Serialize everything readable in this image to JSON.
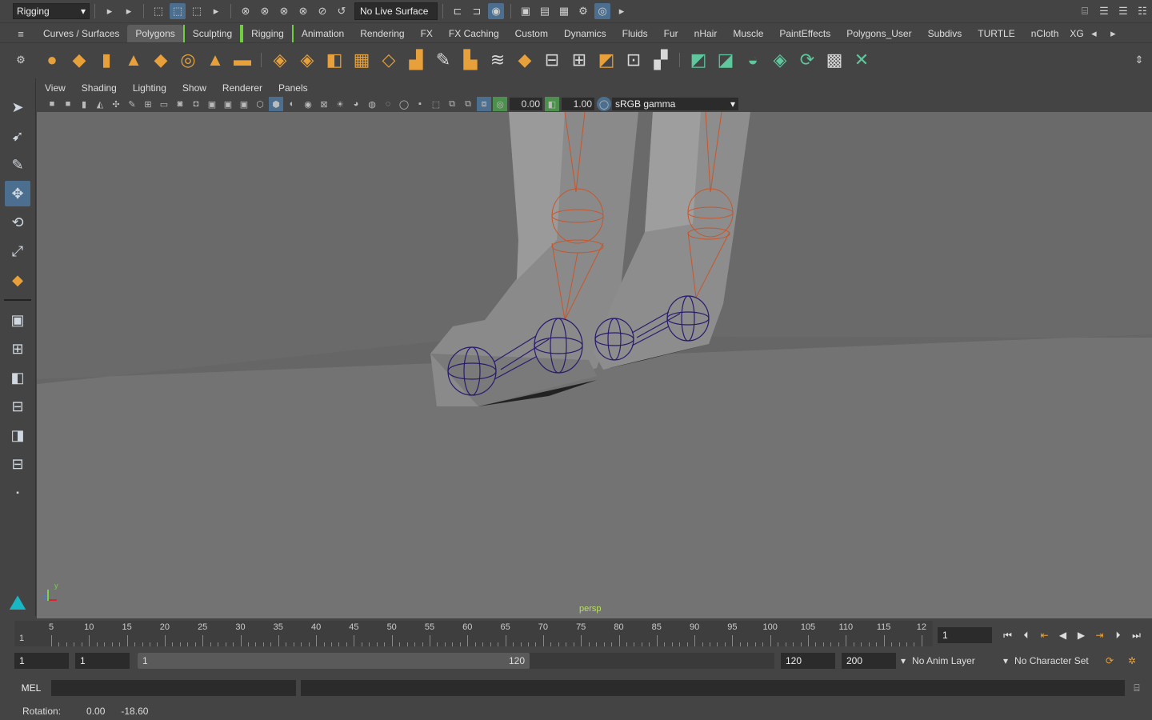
{
  "status_line": {
    "menu_set": "Rigging",
    "live_surface": "No Live Surface"
  },
  "shelf_tabs": [
    "Curves / Surfaces",
    "Polygons",
    "Sculpting",
    "Rigging",
    "Animation",
    "Rendering",
    "FX",
    "FX Caching",
    "Custom",
    "Dynamics",
    "Fluids",
    "Fur",
    "nHair",
    "Muscle",
    "PaintEffects",
    "Polygons_User",
    "Subdivs",
    "TURTLE",
    "nCloth",
    "XG"
  ],
  "active_shelf_tab": "Polygons",
  "panel_menu": [
    "View",
    "Shading",
    "Lighting",
    "Show",
    "Renderer",
    "Panels"
  ],
  "panel_toolbar": {
    "exposure": "0.00",
    "gamma": "1.00",
    "color_space": "sRGB gamma"
  },
  "viewport": {
    "camera": "persp",
    "axis_y": "y",
    "axis_z": "z"
  },
  "timeline": {
    "ticks": [
      "5",
      "10",
      "15",
      "20",
      "25",
      "30",
      "35",
      "40",
      "45",
      "50",
      "55",
      "60",
      "65",
      "70",
      "75",
      "80",
      "85",
      "90",
      "95",
      "100",
      "105",
      "110",
      "115",
      "12"
    ],
    "first_tick": "1",
    "current_frame": "1"
  },
  "range": {
    "start": "1",
    "playback_start": "1",
    "slider_start": "1",
    "slider_end": "120",
    "playback_end": "120",
    "end": "200",
    "anim_layer": "No Anim Layer",
    "character_set": "No Character Set"
  },
  "command_line": {
    "label": "MEL"
  },
  "help_line": {
    "label": "Rotation:",
    "x": "0.00",
    "y": "-18.60"
  },
  "colors": {
    "accent": "#4d6f8f",
    "joint_orange": "#c8562a",
    "joint_purple": "#2a1a6e",
    "shelf_orange": "#e8a13a",
    "shelf_green": "#5fc79d"
  }
}
